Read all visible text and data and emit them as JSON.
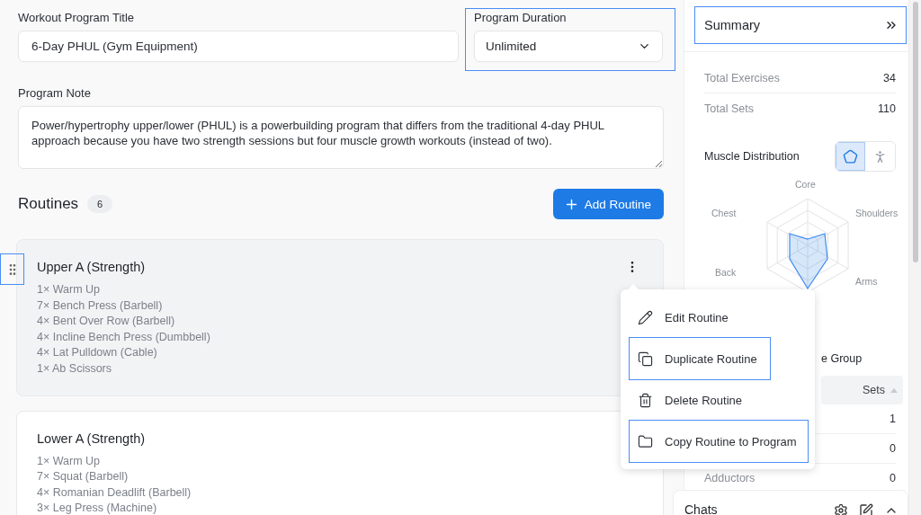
{
  "program_title": {
    "label": "Workout Program Title",
    "value": "6-Day PHUL (Gym Equipment)"
  },
  "duration": {
    "label": "Program Duration",
    "value": "Unlimited",
    "highlighted": true
  },
  "note": {
    "label": "Program Note",
    "value": "Power/hypertrophy upper/lower (PHUL) is a powerbuilding program that differs from the traditional 4-day PHUL approach because you have two strength sessions but four muscle growth workouts (instead of two)."
  },
  "routines": {
    "title": "Routines",
    "count": "6",
    "add_button": "Add Routine",
    "items": [
      {
        "name": "Upper A (Strength)",
        "selected": true,
        "handle_highlighted": true,
        "exercises": [
          "1× Warm Up",
          "7× Bench Press (Barbell)",
          "4× Bent Over Row (Barbell)",
          "4× Incline Bench Press (Dumbbell)",
          "4× Lat Pulldown (Cable)",
          "1× Ab Scissors"
        ]
      },
      {
        "name": "Lower A (Strength)",
        "selected": false,
        "exercises": [
          "1× Warm Up",
          "7× Squat (Barbell)",
          "4× Romanian Deadlift (Barbell)",
          "3× Leg Press (Machine)"
        ]
      }
    ]
  },
  "context_menu": {
    "items": [
      {
        "label": "Edit Routine",
        "highlighted": false
      },
      {
        "label": "Duplicate Routine",
        "highlighted": true
      },
      {
        "label": "Delete Routine",
        "highlighted": false
      },
      {
        "label": "Copy Routine to Program",
        "highlighted": true
      }
    ]
  },
  "summary": {
    "title": "Summary",
    "highlighted": true,
    "stats": [
      {
        "label": "Total Exercises",
        "value": "34"
      },
      {
        "label": "Total Sets",
        "value": "110"
      }
    ],
    "distribution": {
      "title": "Muscle Distribution",
      "views": [
        {
          "kind": "radar",
          "selected": true
        },
        {
          "kind": "body",
          "selected": false
        }
      ],
      "axes": [
        "Core",
        "Shoulders",
        "Arms",
        "Back",
        "Chest"
      ]
    },
    "group_title": "e Group",
    "table": {
      "column": "Sets",
      "rows": [
        {
          "sets": "1"
        },
        {
          "sets": "0"
        },
        {
          "muscle": "Adductors",
          "sets": "0"
        }
      ]
    }
  },
  "chats": {
    "title": "Chats"
  }
}
